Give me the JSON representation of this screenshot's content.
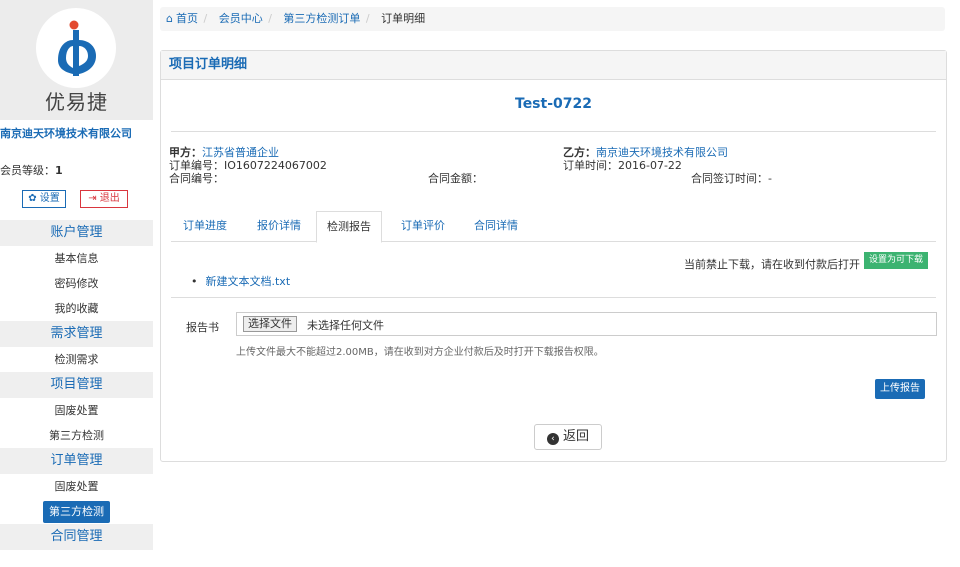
{
  "sidebar": {
    "logo_text": "优易捷",
    "company": "南京迪天环境技术有限公司",
    "level_label": "会员等级：",
    "level_value": "1",
    "settings_label": "设置",
    "logout_label": "退出",
    "groups": [
      {
        "label": "账户管理",
        "items": [
          "基本信息",
          "密码修改",
          "我的收藏"
        ]
      },
      {
        "label": "需求管理",
        "items": [
          "检测需求"
        ]
      },
      {
        "label": "项目管理",
        "items": [
          "固废处置",
          "第三方检测"
        ]
      },
      {
        "label": "订单管理",
        "items": [
          "固废处置",
          "第三方检测"
        ]
      },
      {
        "label": "合同管理",
        "items": []
      }
    ],
    "active_item": "第三方检测"
  },
  "breadcrumb": {
    "home": "首页",
    "member": "会员中心",
    "orders": "第三方检测订单",
    "current": "订单明细",
    "sep": "/"
  },
  "panel": {
    "title": "项目订单明细",
    "order_name": "Test-0722",
    "party_a_label": "甲方：",
    "party_a_value": "江苏省普通企业",
    "order_no_label": "订单编号：",
    "order_no_value": "IO1607224067002",
    "contract_no_label": "合同编号：",
    "contract_no_value": "",
    "contract_amount_label": "合同金额：",
    "contract_amount_value": "",
    "party_b_label": "乙方：",
    "party_b_value": "南京迪天环境技术有限公司",
    "order_time_label": "订单时间：",
    "order_time_value": "2016-07-22",
    "sign_time_label": "合同签订时间：",
    "sign_time_value": "-",
    "tabs": [
      "订单进度",
      "报价详情",
      "检测报告",
      "订单评价",
      "合同详情"
    ],
    "active_tab": "检测报告",
    "download_notice": "当前禁止下载，请在收到付款后打开",
    "enable_download_btn": "设置为可下载",
    "file_name": "新建文本文档.txt",
    "report_label": "报告书",
    "choose_file_btn": "选择文件",
    "no_file_text": "未选择任何文件",
    "upload_hint": "上传文件最大不能超过2.00MB，请在收到对方企业付款后及时打开下载报告权限。",
    "upload_btn": "上传报告",
    "back_btn": "返回"
  },
  "colors": {
    "accent": "#1a6bb5",
    "danger": "#d9363e",
    "success": "#3cb371"
  }
}
